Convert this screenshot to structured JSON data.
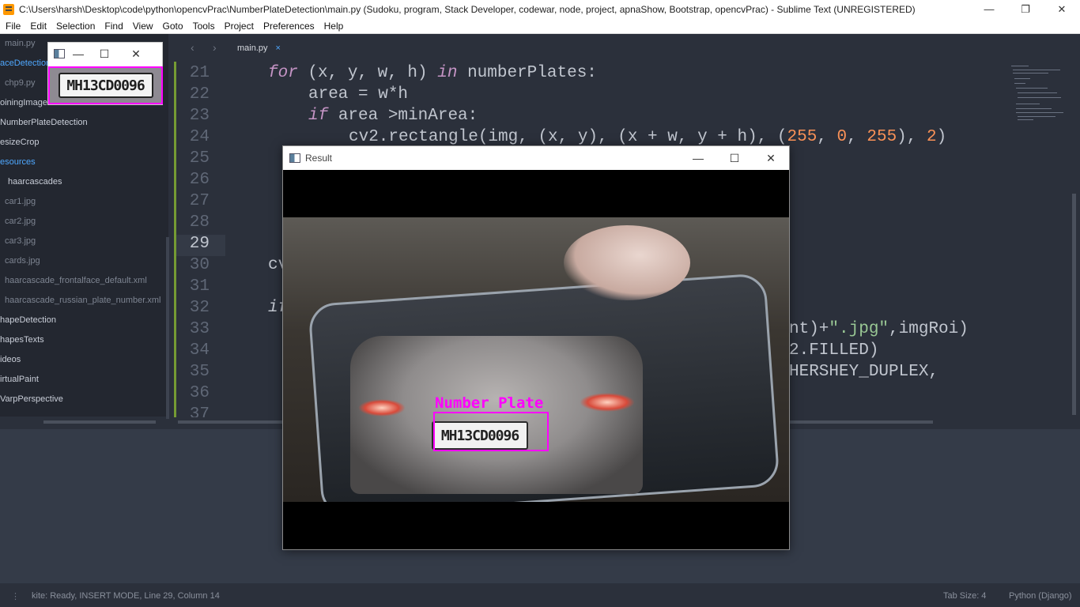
{
  "window": {
    "title": "C:\\Users\\harsh\\Desktop\\code\\python\\opencvPrac\\NumberPlateDetection\\main.py (Sudoku, program, Stack Developer, codewar, node, project, apnaShow, Bootstrap, opencvPrac) - Sublime Text (UNREGISTERED)"
  },
  "menu": [
    "File",
    "Edit",
    "Selection",
    "Find",
    "View",
    "Goto",
    "Tools",
    "Project",
    "Preferences",
    "Help"
  ],
  "sidebar": {
    "items": [
      {
        "label": "main.py",
        "style": "dim"
      },
      {
        "label": "aceDetection",
        "style": "active"
      },
      {
        "label": "chp9.py",
        "style": "dim"
      },
      {
        "label": "oiningImage",
        "style": "plain"
      },
      {
        "label": "NumberPlateDetection",
        "style": "plain"
      },
      {
        "label": "esizeCrop",
        "style": "plain"
      },
      {
        "label": "esources",
        "style": "active"
      },
      {
        "label": "haarcascades",
        "style": "plain"
      },
      {
        "label": "car1.jpg",
        "style": "dim"
      },
      {
        "label": "car2.jpg",
        "style": "dim"
      },
      {
        "label": "car3.jpg",
        "style": "dim"
      },
      {
        "label": "cards.jpg",
        "style": "dim"
      },
      {
        "label": "haarcascade_frontalface_default.xml",
        "style": "dim"
      },
      {
        "label": "haarcascade_russian_plate_number.xml",
        "style": "dim"
      },
      {
        "label": "hapeDetection",
        "style": "plain"
      },
      {
        "label": "hapesTexts",
        "style": "plain"
      },
      {
        "label": "ideos",
        "style": "plain"
      },
      {
        "label": "irtualPaint",
        "style": "plain"
      },
      {
        "label": "VarpPerspective",
        "style": "plain"
      }
    ]
  },
  "tabs": {
    "active": "main.py",
    "close_glyph": "×",
    "nav_back": "‹",
    "nav_forward": "›"
  },
  "editor": {
    "current_line": 29,
    "lines": [
      {
        "n": "21",
        "indent": 0
      },
      {
        "n": "22",
        "indent": 1
      },
      {
        "n": "23",
        "indent": 1
      },
      {
        "n": "24",
        "indent": 2
      },
      {
        "n": "25",
        "indent": 0
      },
      {
        "n": "26",
        "indent": 0
      },
      {
        "n": "27",
        "indent": 0
      },
      {
        "n": "28",
        "indent": 0
      },
      {
        "n": "29",
        "indent": 0
      },
      {
        "n": "30",
        "indent": 0
      },
      {
        "n": "31",
        "indent": 0
      },
      {
        "n": "32",
        "indent": 0
      },
      {
        "n": "33",
        "indent": 0
      },
      {
        "n": "34",
        "indent": 0
      },
      {
        "n": "35",
        "indent": 0
      },
      {
        "n": "36",
        "indent": 0
      },
      {
        "n": "37",
        "indent": 0
      }
    ],
    "code": {
      "l21_kw1": "for",
      "l21_mid": " (x, y, w, h) ",
      "l21_kw2": "in",
      "l21_end": " numberPlates:",
      "l22": "area = w*h",
      "l23_kw": "if",
      "l23_end": " area >minArea:",
      "l24_a": "cv2.rectangle(img, (x, y), (x + w, y + h), (",
      "l24_n1": "255",
      "l24_b": ", ",
      "l24_n2": "0",
      "l24_c": ", ",
      "l24_n3": "255",
      "l24_d": "), ",
      "l24_n4": "2",
      "l24_e": ")",
      "l30": "cv",
      "l32": "if",
      "l33_a": "nt)+",
      "l33_str": "\".jpg\"",
      "l33_b": ",imgRoi)",
      "l34": "2.FILLED)",
      "l35": "HERSHEY_DUPLEX,"
    }
  },
  "plate_window": {
    "minimize": "—",
    "maximize": "☐",
    "close": "✕",
    "plate_text": "MH13CD0096"
  },
  "result_window": {
    "title": "Result",
    "minimize": "—",
    "maximize": "☐",
    "close": "✕",
    "detection_label": "Number Plate",
    "plate_text": "MH13CD0096"
  },
  "status": {
    "left": "kite: Ready, INSERT MODE, Line 29, Column 14",
    "tab_size": "Tab Size: 4",
    "syntax": "Python (Django)"
  },
  "colors": {
    "accent": "#4fa8ff",
    "detection": "#ff00ff",
    "editor_bg": "#2b303b"
  }
}
